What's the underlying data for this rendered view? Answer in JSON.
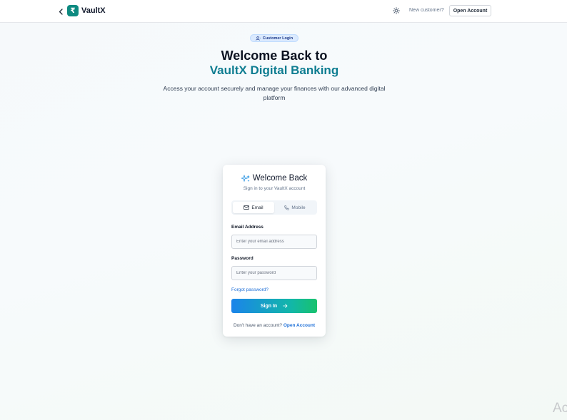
{
  "header": {
    "brand": "VaultX",
    "logo_glyph": "₹",
    "new_customer_text": "New customer?",
    "open_account_label": "Open Account"
  },
  "hero": {
    "badge_label": "Customer Login",
    "title_line1": "Welcome Back to",
    "title_line2": "VaultX Digital Banking",
    "subtitle": "Access your account securely and manage your finances with our advanced digital platform"
  },
  "login_card": {
    "title": "Welcome Back",
    "subtitle": "Sign in to your VaultX account",
    "tabs": [
      {
        "label": "Email",
        "active": true
      },
      {
        "label": "Mobile",
        "active": false
      }
    ],
    "email_label": "Email Address",
    "email_placeholder": "Enter your email address",
    "password_label": "Password",
    "password_placeholder": "Enter your password",
    "forgot_label": "Forgot password?",
    "signin_label": "Sign In",
    "footer_text": "Don't have an account?",
    "footer_link": "Open Account"
  },
  "watermark": "Ac",
  "colors": {
    "brand_teal": "#0d8a80",
    "title_accent": "#0e7d91",
    "link_blue": "#1d6fd8",
    "button_gradient_start": "#1b84ea",
    "button_gradient_end": "#18c26d"
  },
  "icons": {
    "back": "chevron-left-icon",
    "logo": "rupee-icon",
    "theme": "sun-icon",
    "badge": "user-icon",
    "card_header": "sparkle-icon",
    "email_tab": "mail-icon",
    "mobile_tab": "phone-icon",
    "signin_arrow": "arrow-right-icon"
  }
}
